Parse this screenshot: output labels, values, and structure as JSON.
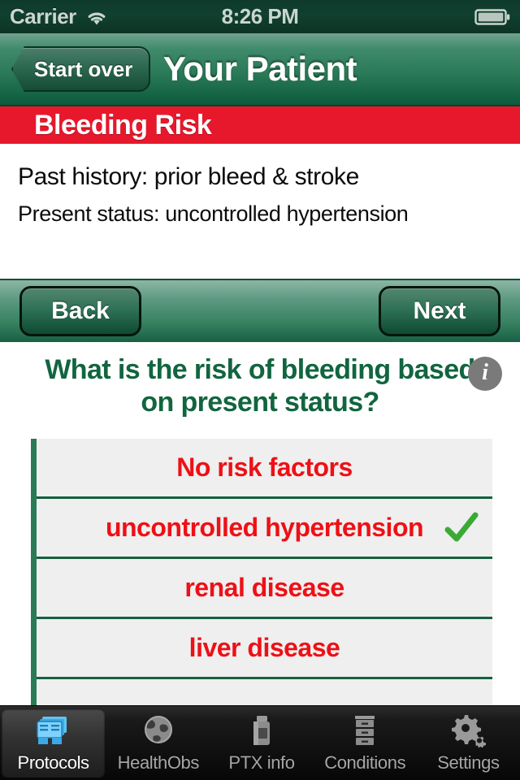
{
  "status_bar": {
    "carrier": "Carrier",
    "time": "8:26 PM",
    "wifi_icon": "wifi-icon",
    "battery_icon": "battery-full-icon"
  },
  "nav_bar": {
    "back_button_label": "Start over",
    "title": "Your Patient"
  },
  "risk_banner": {
    "title": "Bleeding Risk",
    "color": "#e8182c"
  },
  "patient_summary": {
    "past_history": "Past history: prior bleed & stroke",
    "present_status": "Present status: uncontrolled hypertension"
  },
  "toolbar": {
    "back_label": "Back",
    "next_label": "Next"
  },
  "question": {
    "text": "What is the risk of bleeding based on present status?",
    "info_icon": "info-icon",
    "info_glyph": "i",
    "color": "#11653f"
  },
  "options": {
    "accent_color": "#ee1016",
    "check_color": "#3aaa35",
    "items": [
      {
        "label": "No risk factors",
        "selected": false
      },
      {
        "label": "uncontrolled hypertension",
        "selected": true
      },
      {
        "label": "renal disease",
        "selected": false
      },
      {
        "label": "liver disease",
        "selected": false
      },
      {
        "label": "",
        "selected": false
      }
    ]
  },
  "tab_bar": {
    "items": [
      {
        "label": "Protocols",
        "icon": "protocols-icon",
        "active": true
      },
      {
        "label": "HealthObs",
        "icon": "globe-icon",
        "active": false
      },
      {
        "label": "PTX info",
        "icon": "pill-bottle-icon",
        "active": false
      },
      {
        "label": "Conditions",
        "icon": "file-cabinet-icon",
        "active": false
      },
      {
        "label": "Settings",
        "icon": "gears-icon",
        "active": false
      }
    ]
  }
}
